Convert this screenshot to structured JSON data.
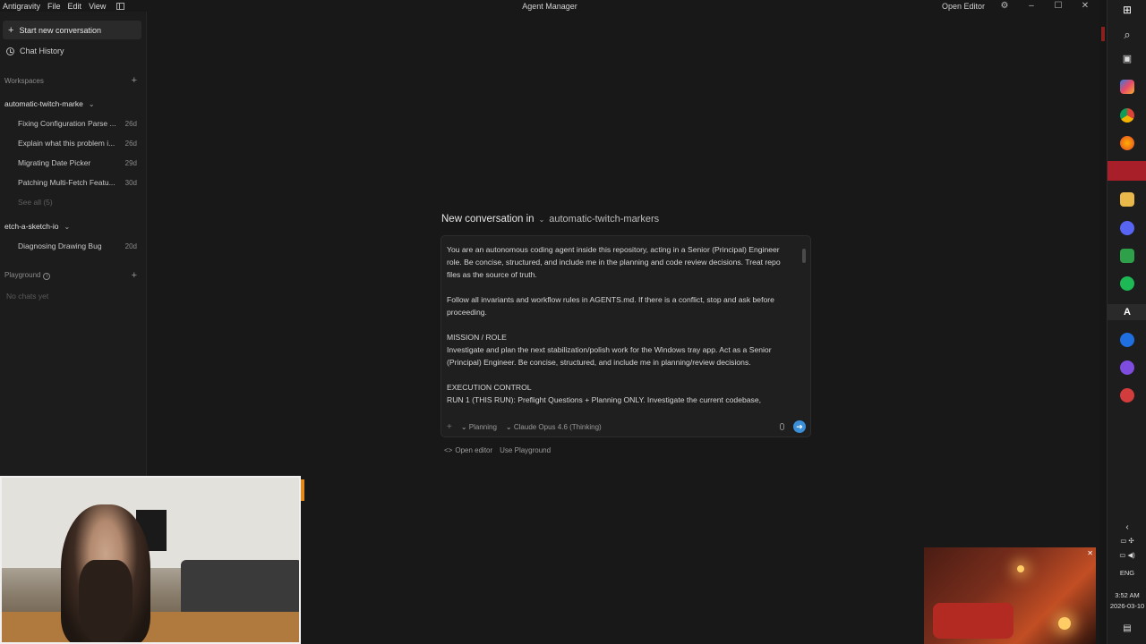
{
  "titlebar": {
    "app": "Antigravity",
    "menus": [
      "File",
      "Edit",
      "View"
    ],
    "title": "Agent Manager",
    "open_editor": "Open Editor"
  },
  "sidebar": {
    "new_conversation": "Start new conversation",
    "chat_history": "Chat History",
    "workspaces_label": "Workspaces",
    "workspaces": [
      {
        "name": "automatic-twitch-marke",
        "items": [
          {
            "title": "Fixing Configuration Parse ...",
            "age": "26d"
          },
          {
            "title": "Explain what this problem i...",
            "age": "26d"
          },
          {
            "title": "Migrating Date Picker",
            "age": "29d"
          },
          {
            "title": "Patching Multi-Fetch Featu...",
            "age": "30d"
          }
        ],
        "see_all": "See all (5)"
      },
      {
        "name": "etch-a-sketch-io",
        "items": [
          {
            "title": "Diagnosing Drawing Bug",
            "age": "20d"
          }
        ]
      }
    ],
    "playground_label": "Playground",
    "playground_empty": "No chats yet"
  },
  "composer": {
    "title": "New conversation in",
    "workspace": "automatic-twitch-markers",
    "prompt_paragraphs": [
      "You are an autonomous coding agent inside this repository, acting in a Senior (Principal) Engineer role. Be concise, structured, and include me in the planning and code review decisions. Treat repo files as the source of truth.",
      "Follow all invariants and workflow rules in AGENTS.md. If there is a conflict, stop and ask before proceeding.",
      "MISSION / ROLE\nInvestigate and plan the next stabilization/polish work for the Windows tray app. Act as a Senior (Principal) Engineer. Be concise, structured, and include me in planning/review decisions.",
      "EXECUTION CONTROL\nRUN 1 (THIS RUN): Preflight Questions + Planning ONLY. Investigate the current codebase,"
    ],
    "mode": "Planning",
    "model": "Claude Opus 4.6 (Thinking)",
    "open_editor": "Open editor",
    "use_playground": "Use Playground"
  },
  "system_tray": {
    "language": "ENG",
    "time": "3:52 AM",
    "date": "2026-03-10"
  },
  "colors": {
    "accent": "#3b8fd8",
    "background": "#181818",
    "sidebar": "#1c1c1c"
  }
}
